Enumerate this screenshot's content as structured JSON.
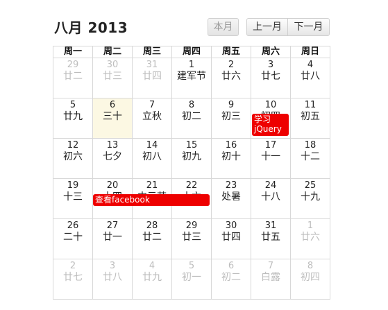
{
  "header": {
    "title": "八月 2013",
    "today_label": "本月",
    "prev_label": "上一月",
    "next_label": "下一月"
  },
  "weekdays": [
    "周一",
    "周二",
    "周三",
    "周四",
    "周五",
    "周六",
    "周日"
  ],
  "weeks": [
    [
      {
        "d": "29",
        "l": "廿二",
        "other": true
      },
      {
        "d": "30",
        "l": "廿三",
        "other": true
      },
      {
        "d": "31",
        "l": "廿四",
        "other": true
      },
      {
        "d": "1",
        "l": "建军节"
      },
      {
        "d": "2",
        "l": "廿六"
      },
      {
        "d": "3",
        "l": "廿七"
      },
      {
        "d": "4",
        "l": "廿八"
      }
    ],
    [
      {
        "d": "5",
        "l": "廿九"
      },
      {
        "d": "6",
        "l": "三十",
        "today": true
      },
      {
        "d": "7",
        "l": "立秋"
      },
      {
        "d": "8",
        "l": "初二"
      },
      {
        "d": "9",
        "l": "初三"
      },
      {
        "d": "10",
        "l": "初四"
      },
      {
        "d": "11",
        "l": "初五"
      }
    ],
    [
      {
        "d": "12",
        "l": "初六"
      },
      {
        "d": "13",
        "l": "七夕"
      },
      {
        "d": "14",
        "l": "初八"
      },
      {
        "d": "15",
        "l": "初九"
      },
      {
        "d": "16",
        "l": "初十"
      },
      {
        "d": "17",
        "l": "十一"
      },
      {
        "d": "18",
        "l": "十二"
      }
    ],
    [
      {
        "d": "19",
        "l": "十三"
      },
      {
        "d": "20",
        "l": "十四"
      },
      {
        "d": "21",
        "l": "中元节"
      },
      {
        "d": "22",
        "l": "十六"
      },
      {
        "d": "23",
        "l": "处暑"
      },
      {
        "d": "24",
        "l": "十八"
      },
      {
        "d": "25",
        "l": "十九"
      }
    ],
    [
      {
        "d": "26",
        "l": "二十"
      },
      {
        "d": "27",
        "l": "廿一"
      },
      {
        "d": "28",
        "l": "廿二"
      },
      {
        "d": "29",
        "l": "廿三"
      },
      {
        "d": "30",
        "l": "廿四"
      },
      {
        "d": "31",
        "l": "廿五"
      },
      {
        "d": "1",
        "l": "廿六",
        "other": true
      }
    ],
    [
      {
        "d": "2",
        "l": "廿七",
        "other": true
      },
      {
        "d": "3",
        "l": "廿八",
        "other": true
      },
      {
        "d": "4",
        "l": "廿九",
        "other": true
      },
      {
        "d": "5",
        "l": "初一",
        "other": true
      },
      {
        "d": "6",
        "l": "初二",
        "other": true
      },
      {
        "d": "7",
        "l": "白露",
        "other": true
      },
      {
        "d": "8",
        "l": "初四",
        "other": true
      }
    ]
  ],
  "events": [
    {
      "title": "学习jQuery"
    },
    {
      "title": "查看facebook"
    }
  ],
  "colors": {
    "event": "#ee0000",
    "today_bg": "#fcf8e3"
  }
}
